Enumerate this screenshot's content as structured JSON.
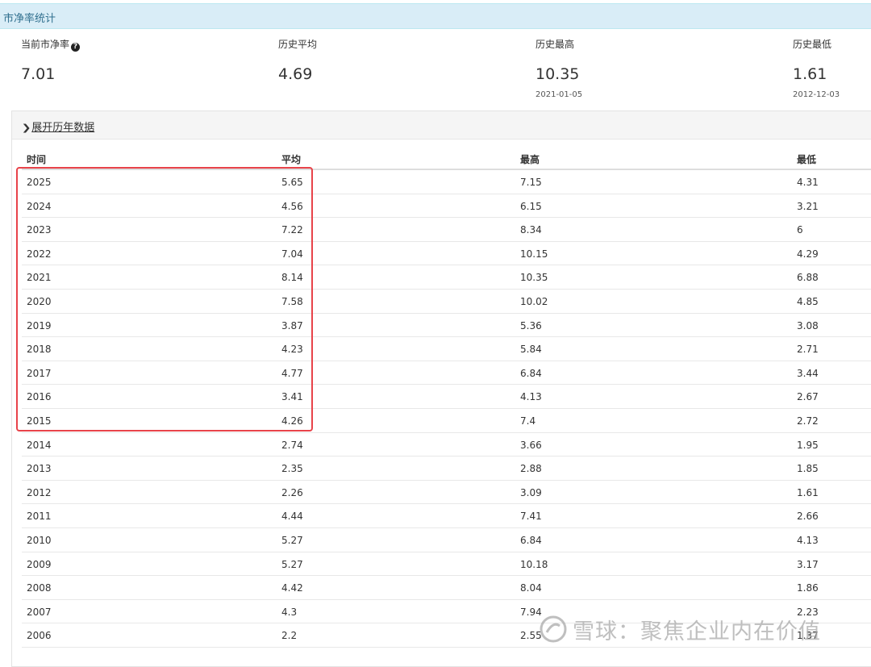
{
  "panel_title": "市净率统计",
  "stats": [
    {
      "label": "当前市净率",
      "value": "7.01",
      "date": ""
    },
    {
      "label": "历史平均",
      "value": "4.69",
      "date": ""
    },
    {
      "label": "历史最高",
      "value": "10.35",
      "date": "2021-01-05"
    },
    {
      "label": "历史最低",
      "value": "1.61",
      "date": "2012-12-03"
    }
  ],
  "help_icon": "?",
  "toggle_label": "展开历年数据",
  "table": {
    "headers": [
      "时间",
      "平均",
      "最高",
      "最低"
    ],
    "rows": [
      [
        "2025",
        "5.65",
        "7.15",
        "4.31"
      ],
      [
        "2024",
        "4.56",
        "6.15",
        "3.21"
      ],
      [
        "2023",
        "7.22",
        "8.34",
        "6"
      ],
      [
        "2022",
        "7.04",
        "10.15",
        "4.29"
      ],
      [
        "2021",
        "8.14",
        "10.35",
        "6.88"
      ],
      [
        "2020",
        "7.58",
        "10.02",
        "4.85"
      ],
      [
        "2019",
        "3.87",
        "5.36",
        "3.08"
      ],
      [
        "2018",
        "4.23",
        "5.84",
        "2.71"
      ],
      [
        "2017",
        "4.77",
        "6.84",
        "3.44"
      ],
      [
        "2016",
        "3.41",
        "4.13",
        "2.67"
      ],
      [
        "2015",
        "4.26",
        "7.4",
        "2.72"
      ],
      [
        "2014",
        "2.74",
        "3.66",
        "1.95"
      ],
      [
        "2013",
        "2.35",
        "2.88",
        "1.85"
      ],
      [
        "2012",
        "2.26",
        "3.09",
        "1.61"
      ],
      [
        "2011",
        "4.44",
        "7.41",
        "2.66"
      ],
      [
        "2010",
        "5.27",
        "6.84",
        "4.13"
      ],
      [
        "2009",
        "5.27",
        "10.18",
        "3.17"
      ],
      [
        "2008",
        "4.42",
        "8.04",
        "1.86"
      ],
      [
        "2007",
        "4.3",
        "7.94",
        "2.23"
      ],
      [
        "2006",
        "2.2",
        "2.55",
        "1.37"
      ]
    ]
  },
  "watermark": "雪球：聚焦企业内在价值",
  "colors": {
    "panel_header_bg": "#d9edf7",
    "panel_header_text": "#31708f",
    "highlight_border": "#e8434a"
  }
}
